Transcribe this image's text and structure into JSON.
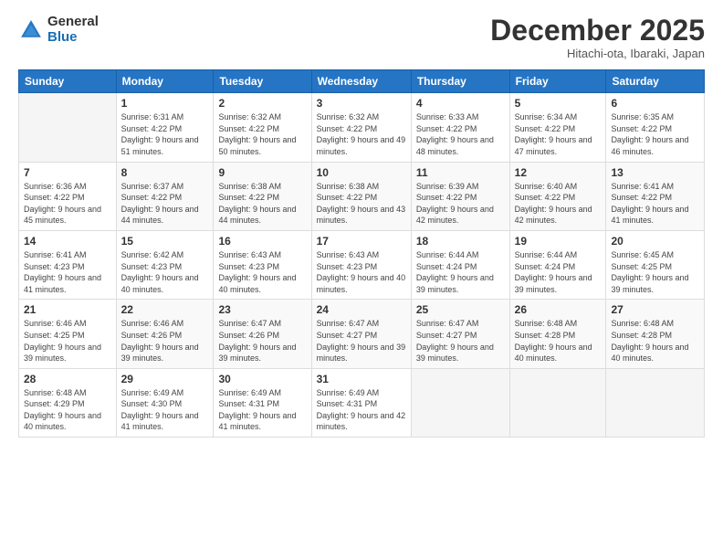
{
  "logo": {
    "general": "General",
    "blue": "Blue"
  },
  "header": {
    "month": "December 2025",
    "location": "Hitachi-ota, Ibaraki, Japan"
  },
  "days_of_week": [
    "Sunday",
    "Monday",
    "Tuesday",
    "Wednesday",
    "Thursday",
    "Friday",
    "Saturday"
  ],
  "weeks": [
    [
      {
        "day": "",
        "sunrise": "",
        "sunset": "",
        "daylight": ""
      },
      {
        "day": "1",
        "sunrise": "Sunrise: 6:31 AM",
        "sunset": "Sunset: 4:22 PM",
        "daylight": "Daylight: 9 hours and 51 minutes."
      },
      {
        "day": "2",
        "sunrise": "Sunrise: 6:32 AM",
        "sunset": "Sunset: 4:22 PM",
        "daylight": "Daylight: 9 hours and 50 minutes."
      },
      {
        "day": "3",
        "sunrise": "Sunrise: 6:32 AM",
        "sunset": "Sunset: 4:22 PM",
        "daylight": "Daylight: 9 hours and 49 minutes."
      },
      {
        "day": "4",
        "sunrise": "Sunrise: 6:33 AM",
        "sunset": "Sunset: 4:22 PM",
        "daylight": "Daylight: 9 hours and 48 minutes."
      },
      {
        "day": "5",
        "sunrise": "Sunrise: 6:34 AM",
        "sunset": "Sunset: 4:22 PM",
        "daylight": "Daylight: 9 hours and 47 minutes."
      },
      {
        "day": "6",
        "sunrise": "Sunrise: 6:35 AM",
        "sunset": "Sunset: 4:22 PM",
        "daylight": "Daylight: 9 hours and 46 minutes."
      }
    ],
    [
      {
        "day": "7",
        "sunrise": "Sunrise: 6:36 AM",
        "sunset": "Sunset: 4:22 PM",
        "daylight": "Daylight: 9 hours and 45 minutes."
      },
      {
        "day": "8",
        "sunrise": "Sunrise: 6:37 AM",
        "sunset": "Sunset: 4:22 PM",
        "daylight": "Daylight: 9 hours and 44 minutes."
      },
      {
        "day": "9",
        "sunrise": "Sunrise: 6:38 AM",
        "sunset": "Sunset: 4:22 PM",
        "daylight": "Daylight: 9 hours and 44 minutes."
      },
      {
        "day": "10",
        "sunrise": "Sunrise: 6:38 AM",
        "sunset": "Sunset: 4:22 PM",
        "daylight": "Daylight: 9 hours and 43 minutes."
      },
      {
        "day": "11",
        "sunrise": "Sunrise: 6:39 AM",
        "sunset": "Sunset: 4:22 PM",
        "daylight": "Daylight: 9 hours and 42 minutes."
      },
      {
        "day": "12",
        "sunrise": "Sunrise: 6:40 AM",
        "sunset": "Sunset: 4:22 PM",
        "daylight": "Daylight: 9 hours and 42 minutes."
      },
      {
        "day": "13",
        "sunrise": "Sunrise: 6:41 AM",
        "sunset": "Sunset: 4:22 PM",
        "daylight": "Daylight: 9 hours and 41 minutes."
      }
    ],
    [
      {
        "day": "14",
        "sunrise": "Sunrise: 6:41 AM",
        "sunset": "Sunset: 4:23 PM",
        "daylight": "Daylight: 9 hours and 41 minutes."
      },
      {
        "day": "15",
        "sunrise": "Sunrise: 6:42 AM",
        "sunset": "Sunset: 4:23 PM",
        "daylight": "Daylight: 9 hours and 40 minutes."
      },
      {
        "day": "16",
        "sunrise": "Sunrise: 6:43 AM",
        "sunset": "Sunset: 4:23 PM",
        "daylight": "Daylight: 9 hours and 40 minutes."
      },
      {
        "day": "17",
        "sunrise": "Sunrise: 6:43 AM",
        "sunset": "Sunset: 4:23 PM",
        "daylight": "Daylight: 9 hours and 40 minutes."
      },
      {
        "day": "18",
        "sunrise": "Sunrise: 6:44 AM",
        "sunset": "Sunset: 4:24 PM",
        "daylight": "Daylight: 9 hours and 39 minutes."
      },
      {
        "day": "19",
        "sunrise": "Sunrise: 6:44 AM",
        "sunset": "Sunset: 4:24 PM",
        "daylight": "Daylight: 9 hours and 39 minutes."
      },
      {
        "day": "20",
        "sunrise": "Sunrise: 6:45 AM",
        "sunset": "Sunset: 4:25 PM",
        "daylight": "Daylight: 9 hours and 39 minutes."
      }
    ],
    [
      {
        "day": "21",
        "sunrise": "Sunrise: 6:46 AM",
        "sunset": "Sunset: 4:25 PM",
        "daylight": "Daylight: 9 hours and 39 minutes."
      },
      {
        "day": "22",
        "sunrise": "Sunrise: 6:46 AM",
        "sunset": "Sunset: 4:26 PM",
        "daylight": "Daylight: 9 hours and 39 minutes."
      },
      {
        "day": "23",
        "sunrise": "Sunrise: 6:47 AM",
        "sunset": "Sunset: 4:26 PM",
        "daylight": "Daylight: 9 hours and 39 minutes."
      },
      {
        "day": "24",
        "sunrise": "Sunrise: 6:47 AM",
        "sunset": "Sunset: 4:27 PM",
        "daylight": "Daylight: 9 hours and 39 minutes."
      },
      {
        "day": "25",
        "sunrise": "Sunrise: 6:47 AM",
        "sunset": "Sunset: 4:27 PM",
        "daylight": "Daylight: 9 hours and 39 minutes."
      },
      {
        "day": "26",
        "sunrise": "Sunrise: 6:48 AM",
        "sunset": "Sunset: 4:28 PM",
        "daylight": "Daylight: 9 hours and 40 minutes."
      },
      {
        "day": "27",
        "sunrise": "Sunrise: 6:48 AM",
        "sunset": "Sunset: 4:28 PM",
        "daylight": "Daylight: 9 hours and 40 minutes."
      }
    ],
    [
      {
        "day": "28",
        "sunrise": "Sunrise: 6:48 AM",
        "sunset": "Sunset: 4:29 PM",
        "daylight": "Daylight: 9 hours and 40 minutes."
      },
      {
        "day": "29",
        "sunrise": "Sunrise: 6:49 AM",
        "sunset": "Sunset: 4:30 PM",
        "daylight": "Daylight: 9 hours and 41 minutes."
      },
      {
        "day": "30",
        "sunrise": "Sunrise: 6:49 AM",
        "sunset": "Sunset: 4:31 PM",
        "daylight": "Daylight: 9 hours and 41 minutes."
      },
      {
        "day": "31",
        "sunrise": "Sunrise: 6:49 AM",
        "sunset": "Sunset: 4:31 PM",
        "daylight": "Daylight: 9 hours and 42 minutes."
      },
      {
        "day": "",
        "sunrise": "",
        "sunset": "",
        "daylight": ""
      },
      {
        "day": "",
        "sunrise": "",
        "sunset": "",
        "daylight": ""
      },
      {
        "day": "",
        "sunrise": "",
        "sunset": "",
        "daylight": ""
      }
    ]
  ]
}
